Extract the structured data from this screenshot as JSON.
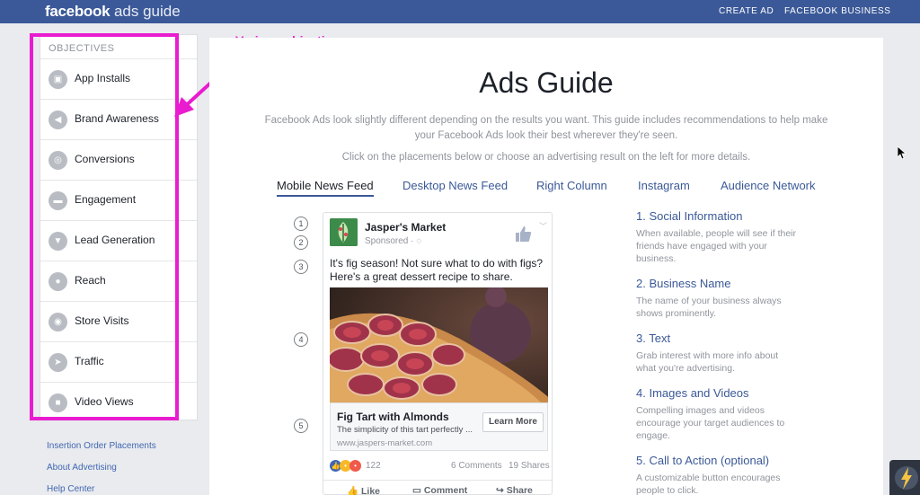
{
  "topbar": {
    "logo_bold": "facebook",
    "logo_light": " ads guide",
    "links": [
      "CREATE AD",
      "FACEBOOK BUSINESS"
    ]
  },
  "sidebar": {
    "heading": "OBJECTIVES",
    "items": [
      {
        "label": "App Installs",
        "icon": "cube-icon"
      },
      {
        "label": "Brand Awareness",
        "icon": "megaphone-icon"
      },
      {
        "label": "Conversions",
        "icon": "globe-icon"
      },
      {
        "label": "Engagement",
        "icon": "chat-bubbles-icon"
      },
      {
        "label": "Lead Generation",
        "icon": "funnel-icon"
      },
      {
        "label": "Reach",
        "icon": "pin-icon"
      },
      {
        "label": "Store Visits",
        "icon": "store-pin-icon"
      },
      {
        "label": "Traffic",
        "icon": "cursor-icon"
      },
      {
        "label": "Video Views",
        "icon": "video-camera-icon"
      }
    ],
    "footer_links": [
      "Insertion Order Placements",
      "About Advertising",
      "Help Center"
    ]
  },
  "annotation": {
    "label": "Various objectives",
    "color": "#e91ccf"
  },
  "main": {
    "title": "Ads Guide",
    "intro": "Facebook Ads look slightly different depending on the results you want. This guide includes recommendations to help make your Facebook Ads look their best wherever they're seen.",
    "hint": "Click on the placements below or choose an advertising result on the left for more details.",
    "tabs": [
      "Mobile News Feed",
      "Desktop News Feed",
      "Right Column",
      "Instagram",
      "Audience Network"
    ],
    "active_tab": "Mobile News Feed",
    "markers": [
      "1",
      "2",
      "3",
      "4",
      "5"
    ]
  },
  "ad": {
    "page_name": "Jasper's Market",
    "sponsored": "Sponsored · ",
    "text": "It's fig season! Not sure what to do with figs? Here's a great dessert recipe to share.",
    "link_title": "Fig Tart with Almonds",
    "link_desc": "The simplicity of this tart perfectly ...",
    "link_url": "www.jaspers-market.com",
    "cta": "Learn More",
    "reaction_count": "122",
    "comments": "6 Comments",
    "shares": "19 Shares",
    "actions": [
      "Like",
      "Comment",
      "Share"
    ]
  },
  "features": [
    {
      "title": "1. Social Information",
      "desc": "When available, people will see if their friends have engaged with your business."
    },
    {
      "title": "2. Business Name",
      "desc": "The name of your business always shows prominently."
    },
    {
      "title": "3. Text",
      "desc": "Grab interest with more info about what you're advertising."
    },
    {
      "title": "4. Images and Videos",
      "desc": "Compelling images and videos encourage your target audiences to engage."
    },
    {
      "title": "5. Call to Action (optional)",
      "desc": "A customizable button encourages people to click."
    }
  ],
  "colors": {
    "brand": "#3b5998",
    "accent": "#e91ccf"
  }
}
